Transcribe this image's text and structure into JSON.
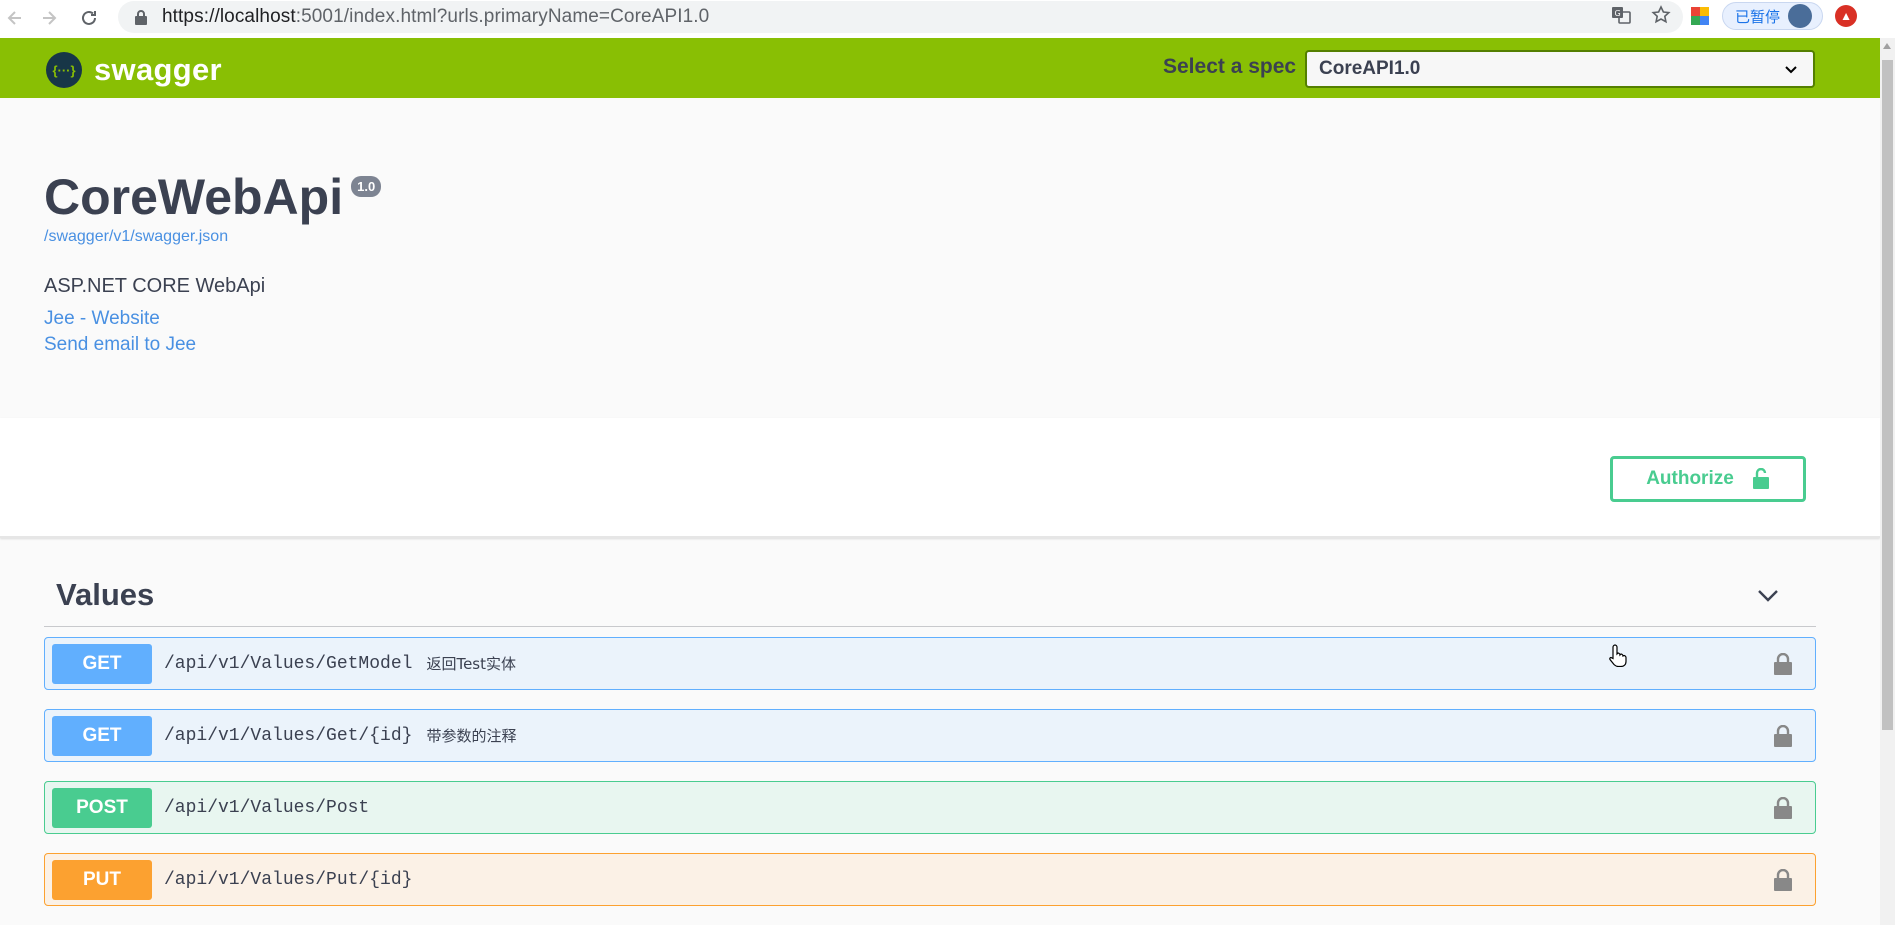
{
  "browser": {
    "url_main": "https://localhost",
    "url_rest": ":5001/index.html?urls.primaryName=CoreAPI1.0",
    "paused_label": "已暂停",
    "icons": [
      "back-icon",
      "forward-icon",
      "reload-icon",
      "lock-icon",
      "translate-icon",
      "star-icon"
    ]
  },
  "topbar": {
    "logo_glyph": "{···}",
    "logo_text": "swagger",
    "spec_label": "Select a spec",
    "spec_value": "CoreAPI1.0"
  },
  "info": {
    "title": "CoreWebApi",
    "version": "1.0",
    "spec_url": "/swagger/v1/swagger.json",
    "description": "ASP.NET CORE WebApi",
    "contact_link": "Jee - Website",
    "email_link": "Send email to Jee"
  },
  "scheme": {
    "authorize_label": "Authorize"
  },
  "tag": {
    "name": "Values"
  },
  "operations": [
    {
      "method": "GET",
      "path": "/api/v1/Values/GetModel",
      "summary": "返回Test实体"
    },
    {
      "method": "GET",
      "path": "/api/v1/Values/Get/{id}",
      "summary": "带参数的注释"
    },
    {
      "method": "POST",
      "path": "/api/v1/Values/Post",
      "summary": ""
    },
    {
      "method": "PUT",
      "path": "/api/v1/Values/Put/{id}",
      "summary": ""
    }
  ],
  "colors": {
    "topbar": "#89bf04",
    "get": "#61affe",
    "post": "#49cc90",
    "put": "#fca130",
    "link": "#4990e2"
  }
}
